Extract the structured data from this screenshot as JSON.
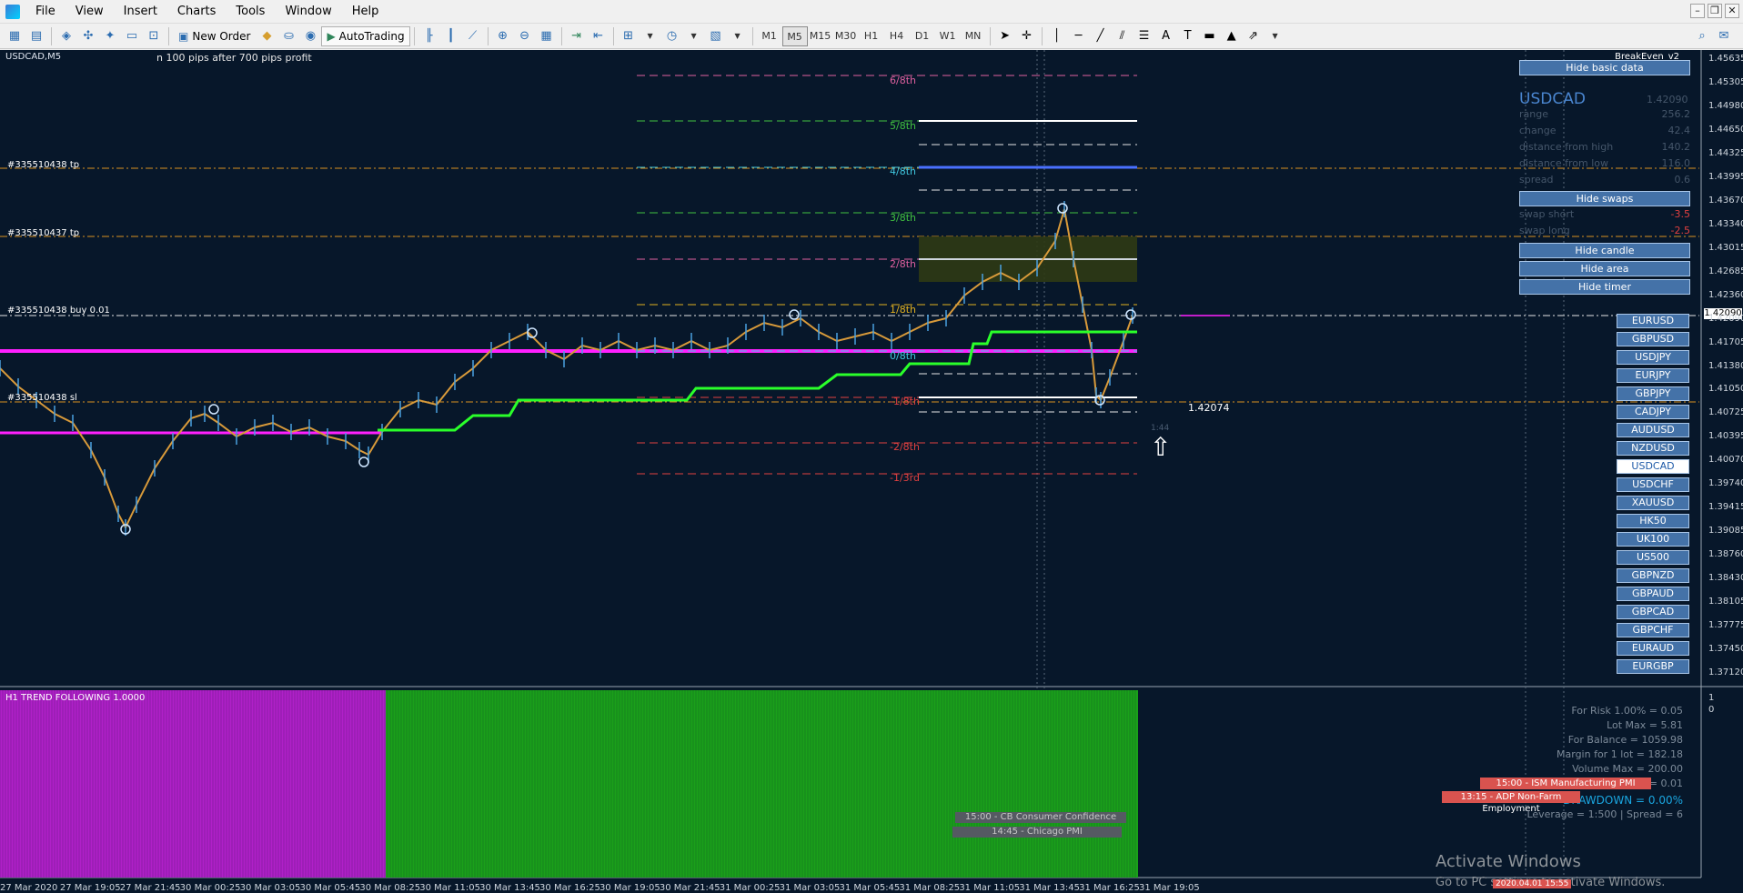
{
  "menubar": {
    "items": [
      "File",
      "View",
      "Insert",
      "Charts",
      "Tools",
      "Window",
      "Help"
    ]
  },
  "toolbar": {
    "new_order_label": "New Order",
    "autotrading_label": "AutoTrading",
    "timeframes": [
      "M1",
      "M5",
      "M15",
      "M30",
      "H1",
      "H4",
      "D1",
      "W1",
      "MN"
    ],
    "active_timeframe": "M5"
  },
  "chart": {
    "symbol_label": "USDCAD,M5",
    "ea_comment": "n 100 pips after 700 pips profit",
    "ea_name": "BreakEven_v2",
    "current_price": "1.42090",
    "price_label_mid": "1.42074",
    "small_time_label": "1:44",
    "price_axis": [
      "1.45635",
      "1.45305",
      "1.44980",
      "1.44650",
      "1.44325",
      "1.43995",
      "1.43670",
      "1.43340",
      "1.43015",
      "1.42685",
      "1.42360",
      "1.42090",
      "1.41705",
      "1.41380",
      "1.41050",
      "1.40725",
      "1.40395",
      "1.40070",
      "1.39740",
      "1.39415",
      "1.39085",
      "1.38760",
      "1.38430",
      "1.38105",
      "1.37775",
      "1.37450",
      "1.37120"
    ],
    "time_axis": [
      "27 Mar 2020",
      "27 Mar 19:05",
      "27 Mar 21:45",
      "30 Mar 00:25",
      "30 Mar 03:05",
      "30 Mar 05:45",
      "30 Mar 08:25",
      "30 Mar 11:05",
      "30 Mar 13:45",
      "30 Mar 16:25",
      "30 Mar 19:05",
      "30 Mar 21:45",
      "31 Mar 00:25",
      "31 Mar 03:05",
      "31 Mar 05:45",
      "31 Mar 08:25",
      "31 Mar 11:05",
      "31 Mar 13:45",
      "31 Mar 16:25",
      "31 Mar 19:05"
    ],
    "fib_levels": [
      {
        "label": "6/8th",
        "color": "#e060a0"
      },
      {
        "label": "5/8th",
        "color": "#40c040"
      },
      {
        "label": "4/8th",
        "color": "#40c8e0"
      },
      {
        "label": "3/8th",
        "color": "#40c040"
      },
      {
        "label": "2/8th",
        "color": "#e060a0"
      },
      {
        "label": "1/8th",
        "color": "#e0b020"
      },
      {
        "label": "0/8th",
        "color": "#40c8e0"
      },
      {
        "label": "-1/8th",
        "color": "#e04040"
      },
      {
        "label": "-2/8th",
        "color": "#e04040"
      },
      {
        "label": "-1/3rd",
        "color": "#e04040"
      }
    ],
    "orders": [
      {
        "label": "#335510438 tp"
      },
      {
        "label": "#335510437 tp"
      },
      {
        "label": "#335510438 buy 0.01"
      },
      {
        "label": "#335510438 sl"
      }
    ]
  },
  "info_panel": {
    "hide_basic_data": "Hide basic data",
    "symbol": "USDCAD",
    "price": "1.42090",
    "rows": [
      {
        "label": "range",
        "value": "256.2"
      },
      {
        "label": "change",
        "value": "42.4"
      },
      {
        "label": "distance from high",
        "value": "140.2"
      },
      {
        "label": "distance from low",
        "value": "116.0"
      },
      {
        "label": "spread",
        "value": "0.6"
      }
    ],
    "hide_swaps": "Hide swaps",
    "swaps": [
      {
        "label": "swap short",
        "value": "-3.5"
      },
      {
        "label": "swap long",
        "value": "-2.5"
      }
    ],
    "hide_candle": "Hide candle",
    "hide_area": "Hide area",
    "hide_timer": "Hide timer"
  },
  "symbols": [
    "EURUSD",
    "GBPUSD",
    "USDJPY",
    "EURJPY",
    "GBPJPY",
    "CADJPY",
    "AUDUSD",
    "NZDUSD",
    "USDCAD",
    "USDCHF",
    "XAUUSD",
    "HK50",
    "UK100",
    "US500",
    "GBPNZD",
    "GBPAUD",
    "GBPCAD",
    "GBPCHF",
    "EURAUD",
    "EURGBP"
  ],
  "active_symbol": "USDCAD",
  "risk_panel": {
    "for_risk": "For Risk 1.00% = 0.05",
    "lot_max": "Lot Max = 5.81",
    "for_balance": "For Balance = 1059.98",
    "margin": "Margin for 1 lot = 182.18",
    "volume_max": "Volume Max = 200.00",
    "line6": "= 0.01",
    "drawdown": "DRAWDOWN = 0.00%",
    "leverage": "Leverage = 1:500 | Spread = 6"
  },
  "news": {
    "red1": "15:00 - ISM Manufacturing PMI",
    "red2": "13:15 - ADP Non-Farm Employment",
    "gray1": "15:00 - CB Consumer Confidence",
    "gray2": "14:45 - Chicago PMI"
  },
  "indicator": {
    "label": "H1 TREND FOLLOWING 1.0000",
    "value_top": "1",
    "value_bottom": "0"
  },
  "watermark": {
    "title": "Activate Windows",
    "subtitle": "Go to PC settings to activate Windows."
  },
  "bottom_label": "2020.04.01 15:55"
}
